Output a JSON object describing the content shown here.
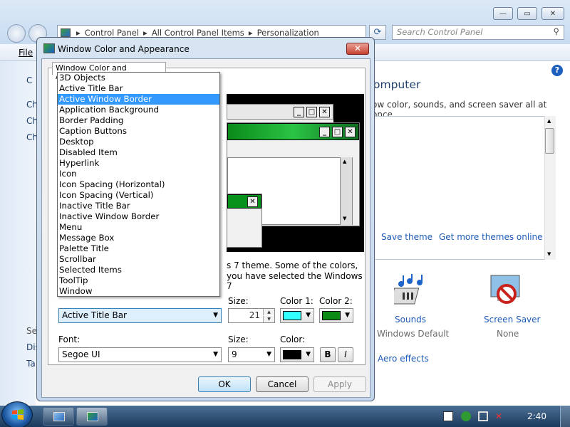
{
  "explorer": {
    "address_parts": [
      "Control Panel",
      "All Control Panel Items",
      "Personalization"
    ],
    "search_placeholder": "Search Control Panel",
    "menu_file": "File",
    "heading": "omputer",
    "description": "ow color, sounds, and screen saver all at once.",
    "left_items": [
      "C",
      "Ch",
      "Ch",
      "Ch"
    ],
    "left_low_items": [
      "Se",
      "Dis",
      "Ta"
    ],
    "save_theme": "Save theme",
    "get_more_themes": "Get more themes online",
    "sounds_label": "Sounds",
    "sounds_value": "Windows Default",
    "saver_label": "Screen Saver",
    "saver_value": "None",
    "aero_effects": "Aero effects"
  },
  "dialog": {
    "title": "Window Color and Appearance",
    "close_glyph": "✕",
    "tab_label": "Window Color and Appearance",
    "info_line1": "s 7 theme.  Some of the colors,",
    "info_line2": "you have selected the Windows 7",
    "item_options": [
      "3D Objects",
      "Active Title Bar",
      "Active Window Border",
      "Application Background",
      "Border Padding",
      "Caption Buttons",
      "Desktop",
      "Disabled Item",
      "Hyperlink",
      "Icon",
      "Icon Spacing (Horizontal)",
      "Icon Spacing (Vertical)",
      "Inactive Title Bar",
      "Inactive Window Border",
      "Menu",
      "Message Box",
      "Palette Title",
      "Scrollbar",
      "Selected Items",
      "ToolTip",
      "Window"
    ],
    "highlighted_option": "Active Window Border",
    "item_selected": "Active Title Bar",
    "size_label": "Size:",
    "size_value": "21",
    "color1_label": "Color 1:",
    "color2_label": "Color 2:",
    "color1": "#33ffff",
    "color2": "#0b8a14",
    "font_label": "Font:",
    "font_value": "Segoe UI",
    "font_size_label": "Size:",
    "font_size_value": "9",
    "font_color_label": "Color:",
    "font_color": "#000000",
    "bold_label": "B",
    "italic_label": "I",
    "ok_label": "OK",
    "cancel_label": "Cancel",
    "apply_label": "Apply"
  },
  "preview": {
    "min_glyph": "_",
    "max_glyph": "□",
    "close_glyph": "✕"
  },
  "taskbar": {
    "clock": "2:40"
  },
  "colors": {
    "active_title": "#0b8a14",
    "selection": "#3399ff"
  }
}
